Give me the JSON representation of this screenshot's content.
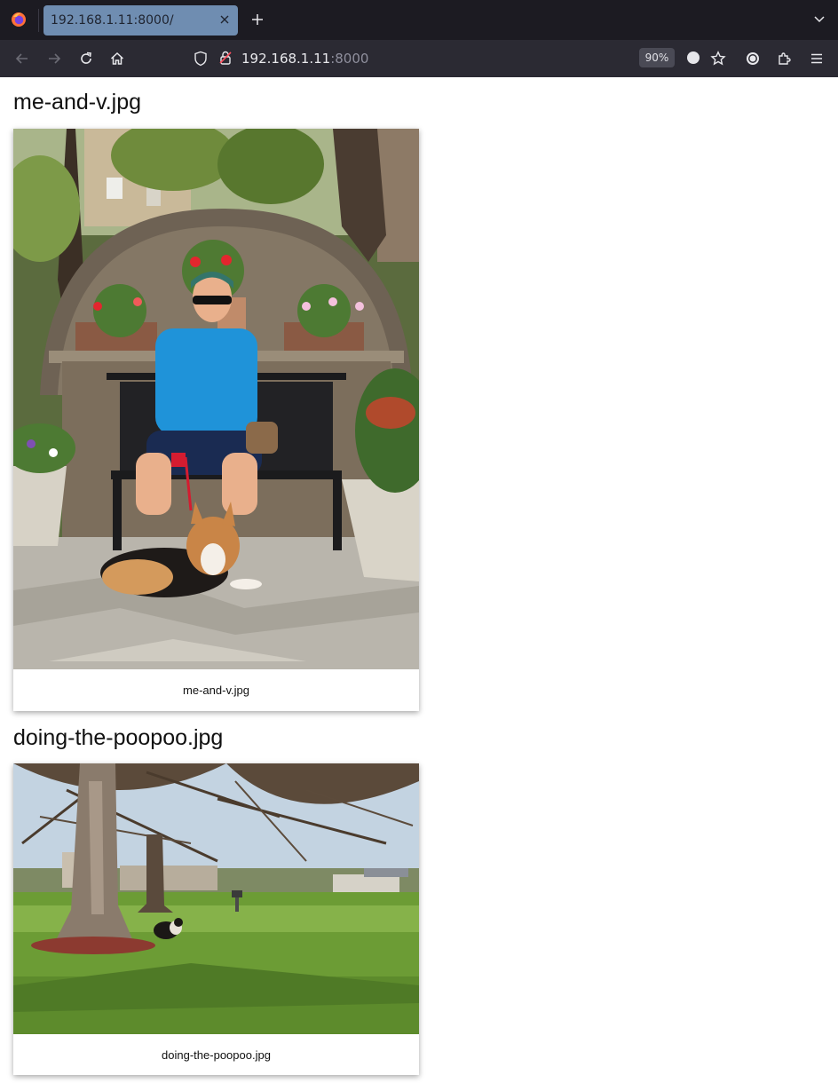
{
  "browser": {
    "tab_title": "192.168.1.11:8000/",
    "url_host": "192.168.1.11",
    "url_port": ":8000",
    "zoom": "90%"
  },
  "images": [
    {
      "heading": "me-and-v.jpg",
      "caption": "me-and-v.jpg"
    },
    {
      "heading": "doing-the-poopoo.jpg",
      "caption": "doing-the-poopoo.jpg"
    }
  ],
  "colors": {
    "tabbar_bg": "#1c1b22",
    "navbar_bg": "#2b2a33",
    "active_tab": "#6f8db1"
  }
}
